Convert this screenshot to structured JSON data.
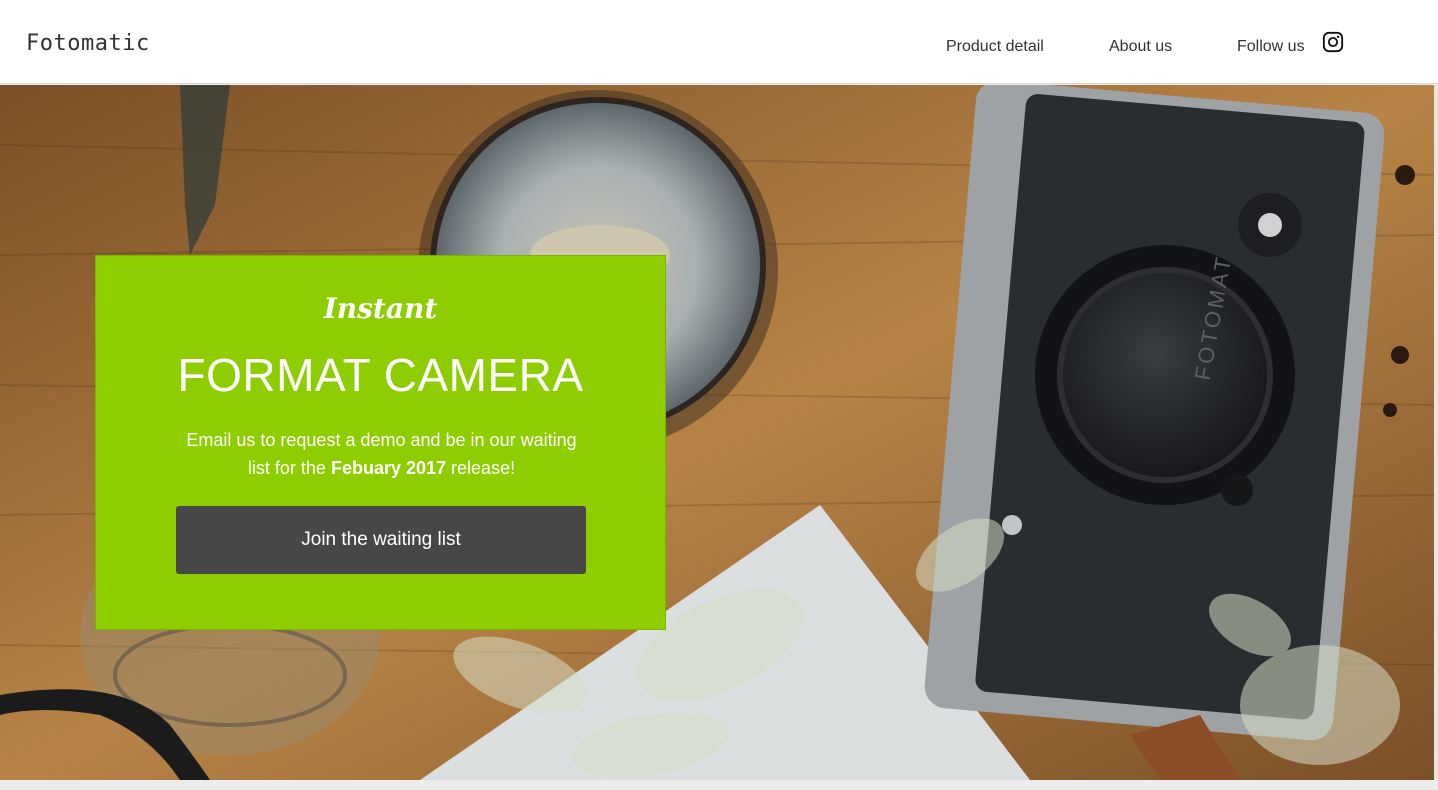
{
  "header": {
    "logo": "Fotomatic",
    "nav": {
      "product_detail": "Product detail",
      "about_us": "About us",
      "follow_us": "Follow us"
    },
    "social_icon": "instagram-icon"
  },
  "hero": {
    "background_description_icon": "camera-photo-background",
    "cap_text": "FOTOMAT",
    "card": {
      "kicker": "Instant",
      "title": "FORMAT CAMERA",
      "desc_prefix": "Email us to request a demo and be in our waiting list for the",
      "desc_bold": "Febuary 2017",
      "desc_suffix": "release!",
      "button_label": "Join the waiting list"
    }
  },
  "colors": {
    "card_green": "#8ecd00",
    "button_dark": "#474747"
  }
}
